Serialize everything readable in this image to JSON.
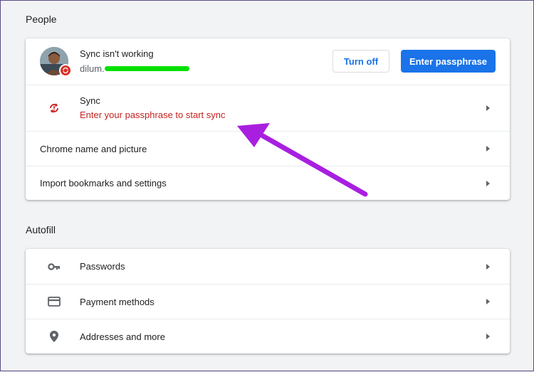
{
  "people": {
    "section_title": "People",
    "profile": {
      "status": "Sync isn't working",
      "email_prefix": "dilum.",
      "turn_off_label": "Turn off",
      "enter_passphrase_label": "Enter passphrase"
    },
    "sync": {
      "title": "Sync",
      "subtitle": "Enter your passphrase to start sync",
      "icon": "sync-error-icon",
      "error_color": "#c5221f"
    },
    "chrome_name_label": "Chrome name and picture",
    "import_label": "Import bookmarks and settings"
  },
  "autofill": {
    "section_title": "Autofill",
    "items": [
      {
        "label": "Passwords",
        "icon": "key-icon"
      },
      {
        "label": "Payment methods",
        "icon": "credit-card-icon"
      },
      {
        "label": "Addresses and more",
        "icon": "location-pin-icon"
      }
    ]
  },
  "colors": {
    "accent": "#1a73e8",
    "background": "#f1f3f4",
    "annotation_arrow": "#a81fe0",
    "redaction": "#00e000"
  }
}
